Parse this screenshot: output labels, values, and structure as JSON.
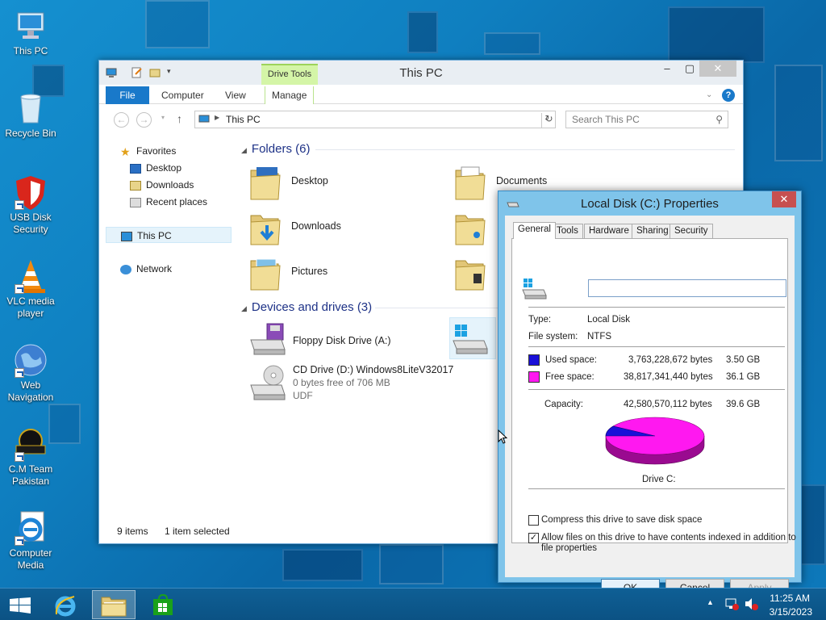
{
  "desktop": {
    "icons": [
      {
        "label": "This PC"
      },
      {
        "label": "Recycle Bin"
      },
      {
        "label": "USB Disk Security"
      },
      {
        "label": "VLC media player"
      },
      {
        "label": "Web Navigation"
      },
      {
        "label": "C.M Team Pakistan"
      },
      {
        "label": "Computer Media"
      }
    ]
  },
  "explorer": {
    "title": "This PC",
    "contextual_tab_group": "Drive Tools",
    "tabs": {
      "file": "File",
      "computer": "Computer",
      "view": "View",
      "manage": "Manage"
    },
    "address": "This PC",
    "search_placeholder": "Search This PC",
    "nav": {
      "favorites": "Favorites",
      "desktop": "Desktop",
      "downloads": "Downloads",
      "recent": "Recent places",
      "this_pc": "This PC",
      "network": "Network"
    },
    "folders_header": "Folders (6)",
    "folders": [
      "Desktop",
      "Documents",
      "Downloads",
      "Music",
      "Pictures",
      "Videos"
    ],
    "devices_header": "Devices and drives (3)",
    "drives": {
      "floppy": "Floppy Disk Drive (A:)",
      "cd_name": "CD Drive (D:) Windows8LiteV32017",
      "cd_free": "0 bytes free of 706 MB",
      "cd_fs": "UDF"
    },
    "status": {
      "items": "9 items",
      "selected": "1 item selected"
    }
  },
  "properties": {
    "title": "Local Disk (C:) Properties",
    "tabs": [
      "General",
      "Tools",
      "Hardware",
      "Sharing",
      "Security"
    ],
    "name_value": "",
    "type_label": "Type:",
    "type_value": "Local Disk",
    "fs_label": "File system:",
    "fs_value": "NTFS",
    "used_label": "Used space:",
    "used_bytes": "3,763,228,672 bytes",
    "used_gb": "3.50 GB",
    "free_label": "Free space:",
    "free_bytes": "38,817,341,440 bytes",
    "free_gb": "36.1 GB",
    "capacity_label": "Capacity:",
    "capacity_bytes": "42,580,570,112 bytes",
    "capacity_gb": "39.6 GB",
    "drive_label": "Drive C:",
    "compress_label": "Compress this drive to save disk space",
    "compress_checked": false,
    "index_label_1": "Allow files on this drive to have contents indexed in addition to",
    "index_label_2": "file properties",
    "index_checked": true,
    "buttons": {
      "ok": "OK",
      "cancel": "Cancel",
      "apply": "Apply"
    },
    "colors": {
      "used": "#1a10d8",
      "free": "#ff18f0"
    }
  },
  "pie": {
    "used_fraction": 0.0884,
    "free_fraction": 0.9116
  },
  "taskbar": {
    "time": "11:25 AM",
    "date": "3/15/2023"
  }
}
